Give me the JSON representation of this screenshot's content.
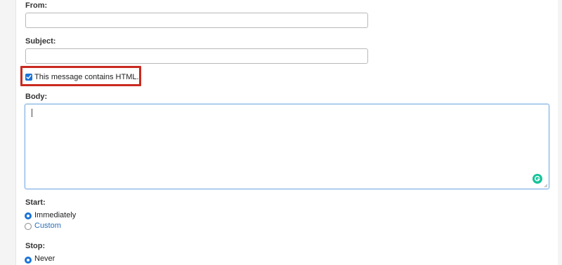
{
  "form": {
    "from": {
      "label": "From:",
      "value": "",
      "placeholder": ""
    },
    "subject": {
      "label": "Subject:",
      "value": "",
      "placeholder": ""
    },
    "html_option": {
      "label": "This message contains HTML.",
      "checked": true
    },
    "body": {
      "label": "Body:",
      "value": ""
    },
    "start": {
      "label": "Start:",
      "options": [
        {
          "label": "Immediately",
          "selected": true
        },
        {
          "label": "Custom",
          "selected": false
        }
      ]
    },
    "stop": {
      "label": "Stop:",
      "options": [
        {
          "label": "Never",
          "selected": true
        }
      ]
    }
  },
  "icons": {
    "checkbox_check": "checkmark-icon",
    "grammarly": "grammarly-icon",
    "resize": "resize-grip-icon"
  },
  "colors": {
    "accent": "#1a73d8",
    "highlight_border": "#c92a20",
    "link": "#2a6fb3",
    "grammarly": "#15c39a",
    "input_border": "#b9b9b9",
    "focus_border": "#7db0e2"
  }
}
